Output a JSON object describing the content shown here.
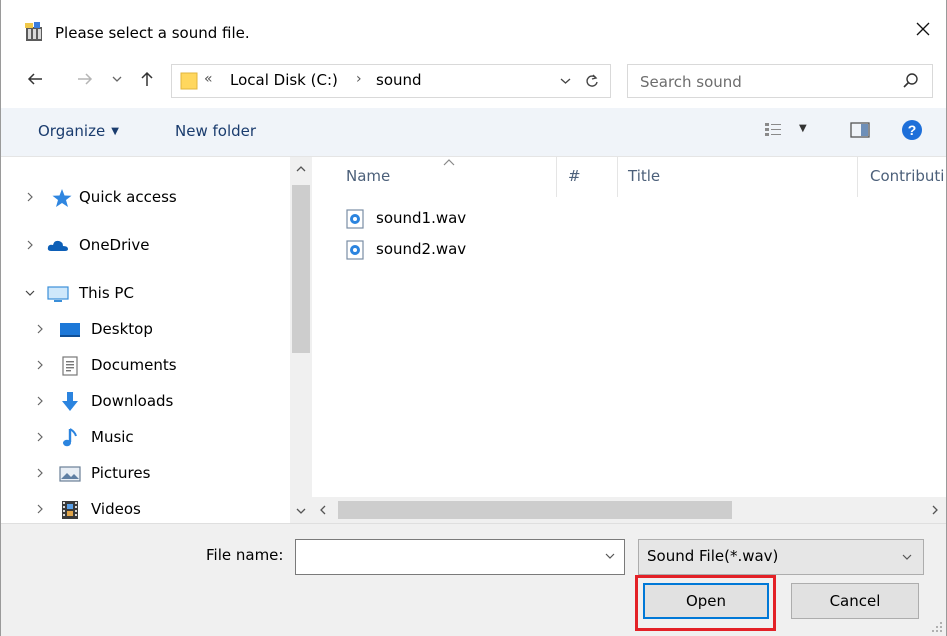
{
  "window": {
    "title": "Please select a sound file."
  },
  "nav": {
    "address": {
      "overflow": "«",
      "crumbs": [
        "Local Disk (C:)",
        "sound"
      ]
    },
    "search": {
      "placeholder": "Search sound"
    }
  },
  "toolbar": {
    "organize_label": "Organize",
    "new_folder_label": "New folder"
  },
  "sidebar": {
    "items": [
      {
        "label": "Quick access",
        "icon": "star-icon"
      },
      {
        "label": "OneDrive",
        "icon": "cloud-icon"
      },
      {
        "label": "This PC",
        "icon": "monitor-icon"
      },
      {
        "label": "Desktop",
        "icon": "desktop-icon"
      },
      {
        "label": "Documents",
        "icon": "documents-icon"
      },
      {
        "label": "Downloads",
        "icon": "download-arrow-icon"
      },
      {
        "label": "Music",
        "icon": "music-note-icon"
      },
      {
        "label": "Pictures",
        "icon": "pictures-icon"
      },
      {
        "label": "Videos",
        "icon": "film-icon"
      }
    ]
  },
  "filelist": {
    "columns": [
      "Name",
      "#",
      "Title",
      "Contributi"
    ],
    "files": [
      {
        "name": "sound1.wav"
      },
      {
        "name": "sound2.wav"
      }
    ]
  },
  "footer": {
    "file_name_label": "File name:",
    "file_name_value": "",
    "filter_value": "Sound File(*.wav)",
    "open_label": "Open",
    "cancel_label": "Cancel"
  },
  "colors": {
    "accent": "#0078d7",
    "highlight": "#e32127",
    "folder": "#ffd75e",
    "help": "#1e6fd9"
  }
}
